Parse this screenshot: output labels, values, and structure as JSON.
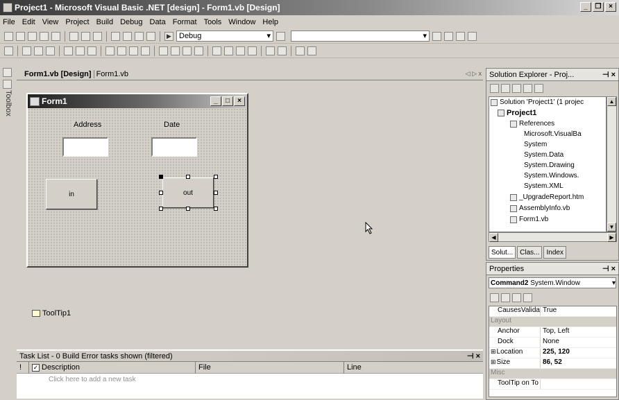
{
  "window": {
    "title": "Project1 - Microsoft Visual Basic .NET [design] - Form1.vb [Design]",
    "controls": [
      "_",
      "ᵐ",
      "x"
    ]
  },
  "menu": [
    "File",
    "Edit",
    "View",
    "Project",
    "Build",
    "Debug",
    "Data",
    "Format",
    "Tools",
    "Window",
    "Help"
  ],
  "toolbar": {
    "config": "Debug"
  },
  "toolbox": {
    "label": "Toolbox"
  },
  "document": {
    "tabs": [
      "Form1.vb [Design]",
      "Form1.vb"
    ],
    "nav": "◁ ▷ x"
  },
  "form1": {
    "title": "Form1",
    "controls_label": "_ □ x",
    "label_address": "Address",
    "label_date": "Date",
    "button_in": "in",
    "button_out": "out"
  },
  "component_tray": {
    "tooltip": "ToolTip1"
  },
  "tasklist": {
    "title": "Task List - 0 Build Error tasks shown (filtered)",
    "controls": "# x",
    "col_bang": "!",
    "col_description": "Description",
    "col_file": "File",
    "col_line": "Line",
    "new_task": "Click here to add a new task"
  },
  "solution_explorer": {
    "title": "Solution Explorer - Proj...",
    "controls": "# x",
    "items": [
      "Solution 'Project1' (1 projec",
      "Project1",
      "References",
      "Microsoft.VisualBa",
      "System",
      "System.Data",
      "System.Drawing",
      "System.Windows.",
      "System.XML",
      "_UpgradeReport.htm",
      "AssemblyInfo.vb",
      "Form1.vb"
    ],
    "tabs": [
      "Solut...",
      "Clas...",
      "Index"
    ]
  },
  "properties": {
    "title": "Properties",
    "controls": "# x",
    "object": "Command2",
    "object_type": "System.Window",
    "rows": [
      {
        "name": "CausesValidat",
        "value": "True"
      },
      {
        "name": "Layout",
        "value": ""
      },
      {
        "name": "Anchor",
        "value": "Top, Left"
      },
      {
        "name": "Dock",
        "value": "None"
      },
      {
        "name": "Location",
        "value": "225, 120"
      },
      {
        "name": "Size",
        "value": "86, 52"
      },
      {
        "name": "Misc",
        "value": ""
      },
      {
        "name": "ToolTip on To",
        "value": ""
      }
    ]
  }
}
